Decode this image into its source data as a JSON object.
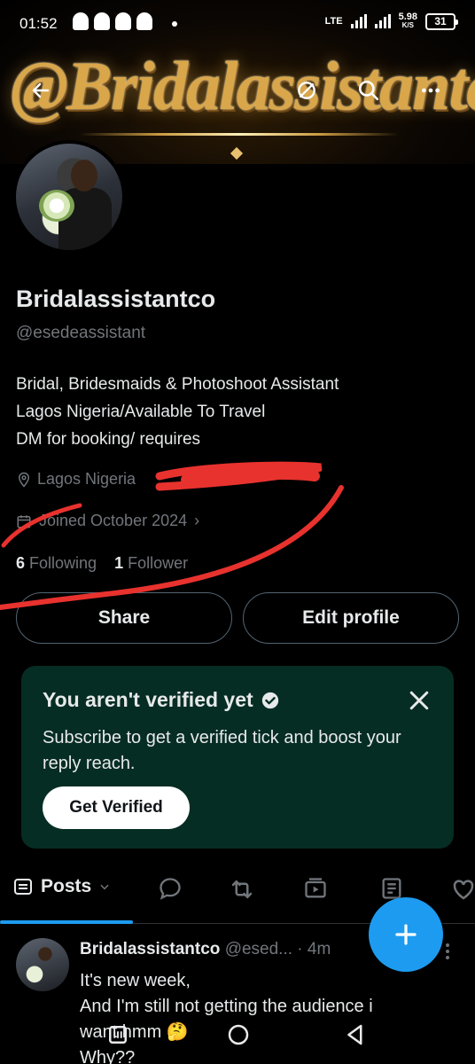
{
  "status_bar": {
    "time": "01:52",
    "network": "LTE",
    "speed": "5.98",
    "speed_unit": "K/S",
    "battery": "31"
  },
  "banner": {
    "logo_text": "@Bridalassistantco"
  },
  "icons": {
    "back": "arrow-left-icon",
    "hide": "eye-slash-icon",
    "search": "search-icon",
    "more": "more-icon"
  },
  "profile": {
    "name": "Bridalassistantco",
    "handle": "@esedeassistant",
    "bio": [
      "Bridal, Bridesmaids & Photoshoot Assistant",
      "Lagos Nigeria/Available To Travel",
      "DM for booking/ requires"
    ],
    "location": "Lagos Nigeria",
    "joined": "Joined October 2024",
    "following_count": "6",
    "following_label": "Following",
    "followers_count": "1",
    "followers_label": "Follower"
  },
  "actions": {
    "share": "Share",
    "edit_profile": "Edit profile"
  },
  "verify_card": {
    "title": "You aren't verified yet",
    "text": "Subscribe to get a verified tick and boost your reply reach.",
    "button": "Get Verified"
  },
  "tabs": {
    "posts": "Posts"
  },
  "tweet": {
    "name": "Bridalassistantco",
    "handle": "@esed...",
    "time": "· 4m",
    "lines": [
      "It's new week,",
      "And I'm still not getting the audience i",
      "want hmm 🤔",
      "Why??"
    ]
  },
  "colors": {
    "accent": "#1d9bf0",
    "card_bg": "#062d24",
    "muted": "#71767b"
  }
}
